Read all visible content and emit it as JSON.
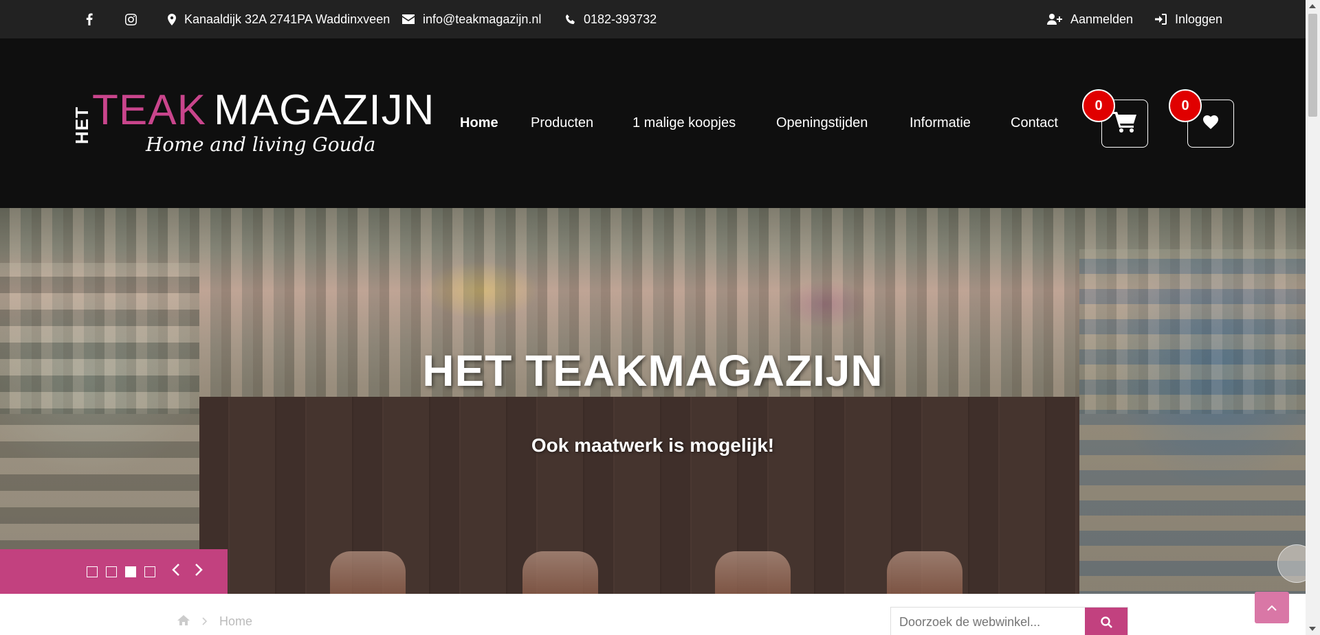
{
  "topbar": {
    "address": "Kanaaldijk 32A 2741PA Waddinxveen",
    "email": "info@teakmagazijn.nl",
    "phone": "0182-393732",
    "register": "Aanmelden",
    "login": "Inloggen"
  },
  "logo": {
    "het": "HET",
    "teak": "TEAK",
    "magazijn": "MAGAZIJN",
    "tagline": "Home and living Gouda"
  },
  "nav": {
    "items": [
      "Home",
      "Producten",
      "1 malige koopjes",
      "Openingstijden",
      "Informatie",
      "Contact"
    ],
    "active": "Home"
  },
  "cart": {
    "count": "0"
  },
  "wishlist": {
    "count": "0"
  },
  "hero": {
    "title": "HET TEAKMAGAZIJN",
    "subtitle": "Ook maatwerk is mogelijk!",
    "slides": 4,
    "active_slide": 3
  },
  "breadcrumb": {
    "home": "Home"
  },
  "search": {
    "placeholder": "Doorzoek de webwinkel..."
  },
  "colors": {
    "accent": "#c2417f",
    "header": "#0f0f0f",
    "topbar": "#222222",
    "badge": "#e00000"
  }
}
